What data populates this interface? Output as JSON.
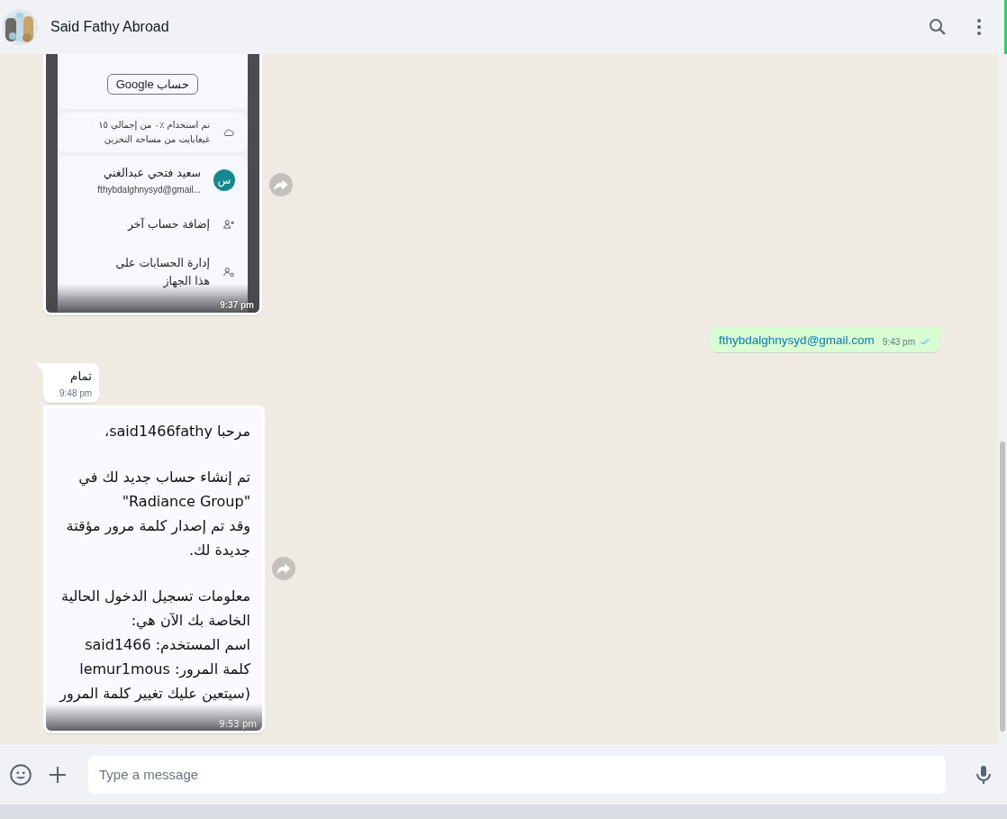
{
  "header": {
    "contact_name": "Said Fathy Abroad"
  },
  "messages": [
    {
      "time": "9:37 pm",
      "screenshot": {
        "google_button": "حساب Google",
        "storage_text": "تم استخدام ٪٠ من إجمالي ١٥ غيغابايت من مساحة التخزين",
        "account": {
          "avatar_letter": "س",
          "name": "سعيد فتحي عبدالغني",
          "email": "fthybdalghnysyd@gmail..."
        },
        "menu_items": [
          {
            "kind": "add",
            "label": "إضافة حساب آخر"
          },
          {
            "kind": "manage",
            "label": "إدارة الحسابات على هذا الجهاز"
          }
        ]
      }
    },
    {
      "kind": "outgoing",
      "text": "fthybdalghnysyd@gmail.com",
      "time": "9:43 pm",
      "read": true
    },
    {
      "kind": "incoming",
      "text": "تمام",
      "time": "9:48 pm"
    },
    {
      "kind": "long",
      "time": "9:53 pm",
      "paragraphs": [
        [
          "مرحبا said1466fathy،"
        ],
        [
          "تم إنشاء حساب جديد لك في \"Radiance Group\"",
          "وقد تم إصدار كلمة مرور مؤقتة جديدة لك."
        ],
        [
          "معلومات تسجيل الدخول الحالية الخاصة بك الآن هي:",
          "اسم المستخدم: said1466",
          "كلمة المرور: lemur1mous",
          "(سيتعين عليك تغيير كلمة المرور"
        ]
      ]
    }
  ],
  "composer": {
    "placeholder": "Type a message"
  }
}
